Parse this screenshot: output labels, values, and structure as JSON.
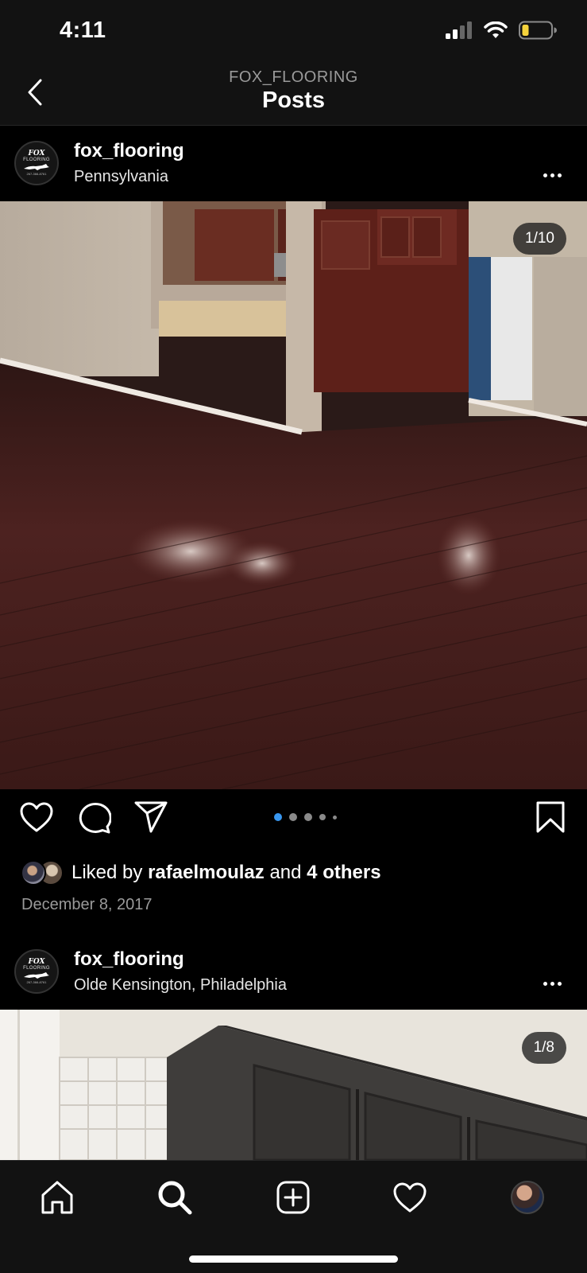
{
  "status_bar": {
    "time": "4:11"
  },
  "header": {
    "subtitle": "FOX_FLOORING",
    "title": "Posts"
  },
  "avatar_logo": {
    "line1": "FOX",
    "line2": "FLOORING",
    "phone": "267-366-8761"
  },
  "posts": [
    {
      "username": "fox_flooring",
      "location": "Pennsylvania",
      "counter": "1/10",
      "carousel": {
        "current_index": 0,
        "dot_count": 5
      },
      "liked_by": {
        "prefix": "Liked by",
        "user": "rafaelmoulaz",
        "joiner": "and",
        "others": "4 others"
      },
      "date": "December 8, 2017"
    },
    {
      "username": "fox_flooring",
      "location": "Olde Kensington, Philadelphia",
      "counter": "1/8"
    }
  ],
  "icons": {
    "back": "chevron-left-icon",
    "more": "more-horizontal-icon",
    "like": "heart-icon",
    "comment": "comment-icon",
    "share": "send-icon",
    "save": "bookmark-icon",
    "tabs": [
      "home-icon",
      "search-icon",
      "add-post-icon",
      "activity-heart-icon",
      "profile-avatar"
    ]
  },
  "colors": {
    "background": "#000000",
    "bar": "#121212",
    "accent_dot": "#3897f0",
    "battery_low": "#f5d33c"
  }
}
